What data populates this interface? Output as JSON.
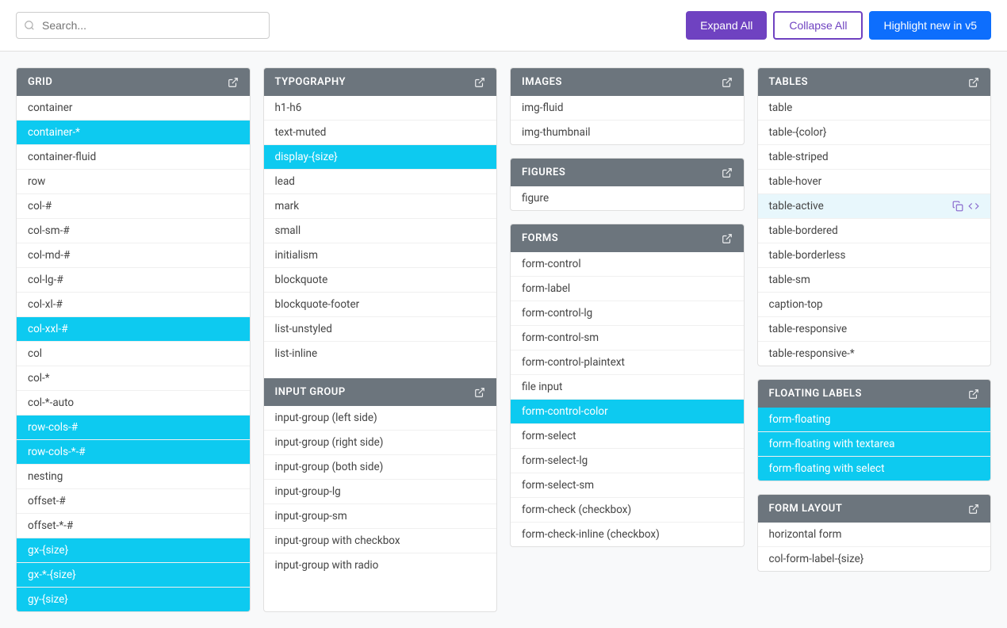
{
  "topbar": {
    "search_placeholder": "Search...",
    "expand_label": "Expand All",
    "collapse_label": "Collapse All",
    "highlight_label": "Highlight new in v5"
  },
  "panels": {
    "grid": {
      "title": "GRID",
      "items": [
        {
          "label": "container",
          "active": false
        },
        {
          "label": "container-*",
          "active": true
        },
        {
          "label": "container-fluid",
          "active": false
        },
        {
          "label": "row",
          "active": false
        },
        {
          "label": "col-#",
          "active": false
        },
        {
          "label": "col-sm-#",
          "active": false
        },
        {
          "label": "col-md-#",
          "active": false
        },
        {
          "label": "col-lg-#",
          "active": false
        },
        {
          "label": "col-xl-#",
          "active": false
        },
        {
          "label": "col-xxl-#",
          "active": true
        },
        {
          "label": "col",
          "active": false
        },
        {
          "label": "col-*",
          "active": false
        },
        {
          "label": "col-*-auto",
          "active": false
        },
        {
          "label": "row-cols-#",
          "active": true
        },
        {
          "label": "row-cols-*-#",
          "active": true
        },
        {
          "label": "nesting",
          "active": false
        },
        {
          "label": "offset-#",
          "active": false
        },
        {
          "label": "offset-*-#",
          "active": false
        },
        {
          "label": "gx-{size}",
          "active": true
        },
        {
          "label": "gx-*-{size}",
          "active": true
        },
        {
          "label": "gy-{size}",
          "active": true
        }
      ]
    },
    "typography": {
      "title": "TYPOGRAPHY",
      "items": [
        {
          "label": "h1-h6",
          "active": false
        },
        {
          "label": "text-muted",
          "active": false
        },
        {
          "label": "display-{size}",
          "active": true
        },
        {
          "label": "lead",
          "active": false
        },
        {
          "label": "mark",
          "active": false
        },
        {
          "label": "small",
          "active": false
        },
        {
          "label": "initialism",
          "active": false
        },
        {
          "label": "blockquote",
          "active": false
        },
        {
          "label": "blockquote-footer",
          "active": false
        },
        {
          "label": "list-unstyled",
          "active": false
        },
        {
          "label": "list-inline",
          "active": false
        }
      ]
    },
    "input_group": {
      "title": "INPUT GROUP",
      "items": [
        {
          "label": "input-group (left side)",
          "active": false
        },
        {
          "label": "input-group (right side)",
          "active": false
        },
        {
          "label": "input-group (both side)",
          "active": false
        },
        {
          "label": "input-group-lg",
          "active": false
        },
        {
          "label": "input-group-sm",
          "active": false
        },
        {
          "label": "input-group with checkbox",
          "active": false
        },
        {
          "label": "input-group with radio",
          "active": false
        }
      ]
    },
    "images": {
      "title": "IMAGES",
      "items": [
        {
          "label": "img-fluid",
          "active": false
        },
        {
          "label": "img-thumbnail",
          "active": false
        }
      ]
    },
    "figures": {
      "title": "FIGURES",
      "items": [
        {
          "label": "figure",
          "active": false
        }
      ]
    },
    "forms": {
      "title": "FORMS",
      "items": [
        {
          "label": "form-control",
          "active": false
        },
        {
          "label": "form-label",
          "active": false
        },
        {
          "label": "form-control-lg",
          "active": false
        },
        {
          "label": "form-control-sm",
          "active": false
        },
        {
          "label": "form-control-plaintext",
          "active": false
        },
        {
          "label": "file input",
          "active": false
        },
        {
          "label": "form-control-color",
          "active": true
        },
        {
          "label": "form-select",
          "active": false
        },
        {
          "label": "form-select-lg",
          "active": false
        },
        {
          "label": "form-select-sm",
          "active": false
        },
        {
          "label": "form-check (checkbox)",
          "active": false
        },
        {
          "label": "form-check-inline (checkbox)",
          "active": false
        }
      ]
    },
    "tables": {
      "title": "TABLES",
      "items": [
        {
          "label": "table",
          "active": false
        },
        {
          "label": "table-{color}",
          "active": false
        },
        {
          "label": "table-striped",
          "active": false
        },
        {
          "label": "table-hover",
          "active": false
        },
        {
          "label": "table-active",
          "active": false,
          "has_icons": true
        },
        {
          "label": "table-bordered",
          "active": false
        },
        {
          "label": "table-borderless",
          "active": false
        },
        {
          "label": "table-sm",
          "active": false
        },
        {
          "label": "caption-top",
          "active": false
        },
        {
          "label": "table-responsive",
          "active": false
        },
        {
          "label": "table-responsive-*",
          "active": false
        }
      ]
    },
    "floating_labels": {
      "title": "FLOATING LABELS",
      "items": [
        {
          "label": "form-floating",
          "active": true
        },
        {
          "label": "form-floating with textarea",
          "active": true
        },
        {
          "label": "form-floating with select",
          "active": true
        }
      ]
    },
    "form_layout": {
      "title": "FORM LAYOUT",
      "items": [
        {
          "label": "horizontal form",
          "active": false
        },
        {
          "label": "col-form-label-{size}",
          "active": false
        }
      ]
    }
  }
}
